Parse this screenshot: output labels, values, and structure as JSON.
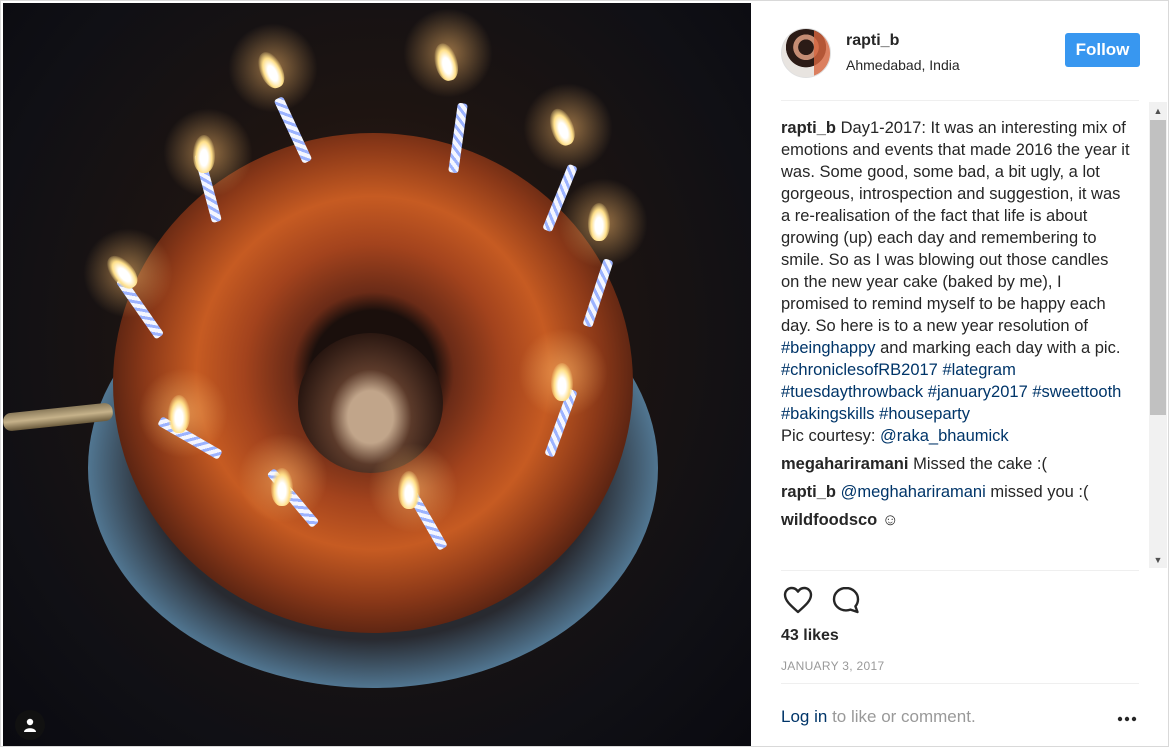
{
  "post": {
    "username": "rapti_b",
    "location": "Ahmedabad, India",
    "follow_label": "Follow",
    "likes": "43 likes",
    "date": "JANUARY 3, 2017",
    "icons": {
      "like": "heart-icon",
      "comment": "speech-bubble-icon",
      "more": "ellipsis-icon",
      "user_tag": "person-icon"
    }
  },
  "caption": {
    "username": "rapti_b",
    "text": "Day1-2017: It was an interesting mix of emotions and events that made 2016 the year it was. Some good, some bad, a bit ugly, a lot gorgeous, introspection and suggestion, it was a re-realisation of the fact that life is about growing (up) each day and remembering to smile. So as I was blowing out those candles on the new year cake (baked by me), I promised to remind myself to be happy each day. So here is to a new year resolution of",
    "tag1": "#beinghappy",
    "mid_text": "and marking each day with a pic.",
    "tag2": "#chroniclesofRB2017",
    "tag3": "#lategram",
    "tag4": "#tuesdaythrowback",
    "tag5": "#january2017",
    "tag6": "#sweettooth",
    "tag7": "#bakingskills",
    "tag8": "#houseparty",
    "credit_prefix": "Pic courtesy:",
    "credit_handle": "@raka_bhaumick"
  },
  "comments": [
    {
      "username": "megahariramani",
      "text": "Missed the cake :("
    },
    {
      "username": "rapti_b",
      "mention": "@meghahariramani",
      "text": "missed you :("
    },
    {
      "username": "wildfoodsco",
      "text": "☺"
    }
  ],
  "footer": {
    "login": "Log in",
    "rest": "to like or comment."
  },
  "colors": {
    "follow": "#3897f0",
    "link": "#003569",
    "muted": "#999999"
  }
}
